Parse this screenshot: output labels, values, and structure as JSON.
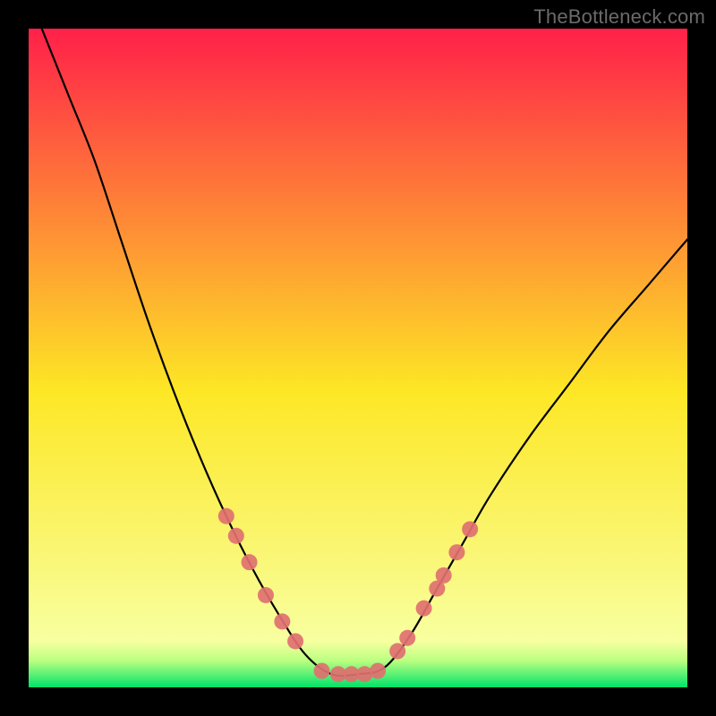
{
  "watermark": "TheBottleneck.com",
  "chart_data": {
    "type": "line",
    "x_range": [
      0,
      100
    ],
    "y_range": [
      0,
      100
    ],
    "title": "",
    "xlabel": "",
    "ylabel": "",
    "grid": false,
    "background_gradient": {
      "top_color": "#ff2049",
      "mid_color": "#fde725",
      "bottom_color": "#00e36a",
      "bottom_band_height_pct": 5
    },
    "series": [
      {
        "name": "bottleneck-curve",
        "color": "#000000",
        "width": 2.2,
        "points": [
          {
            "x": 2,
            "y": 100
          },
          {
            "x": 6,
            "y": 90
          },
          {
            "x": 10,
            "y": 80
          },
          {
            "x": 14,
            "y": 68
          },
          {
            "x": 18,
            "y": 56
          },
          {
            "x": 22,
            "y": 45
          },
          {
            "x": 26,
            "y": 35
          },
          {
            "x": 30,
            "y": 26
          },
          {
            "x": 34,
            "y": 18
          },
          {
            "x": 38,
            "y": 11
          },
          {
            "x": 42,
            "y": 5
          },
          {
            "x": 46,
            "y": 2
          },
          {
            "x": 50,
            "y": 2
          },
          {
            "x": 54,
            "y": 3
          },
          {
            "x": 58,
            "y": 8
          },
          {
            "x": 62,
            "y": 15
          },
          {
            "x": 66,
            "y": 22
          },
          {
            "x": 70,
            "y": 29
          },
          {
            "x": 76,
            "y": 38
          },
          {
            "x": 82,
            "y": 46
          },
          {
            "x": 88,
            "y": 54
          },
          {
            "x": 94,
            "y": 61
          },
          {
            "x": 100,
            "y": 68
          }
        ]
      }
    ],
    "markers": {
      "color": "#e07070",
      "radius": 9,
      "points": [
        {
          "x": 30.0,
          "y": 26
        },
        {
          "x": 31.5,
          "y": 23
        },
        {
          "x": 33.5,
          "y": 19
        },
        {
          "x": 36.0,
          "y": 14
        },
        {
          "x": 38.5,
          "y": 10
        },
        {
          "x": 40.5,
          "y": 7
        },
        {
          "x": 44.5,
          "y": 2.5
        },
        {
          "x": 47.0,
          "y": 2
        },
        {
          "x": 49.0,
          "y": 2
        },
        {
          "x": 51.0,
          "y": 2
        },
        {
          "x": 53.0,
          "y": 2.5
        },
        {
          "x": 56.0,
          "y": 5.5
        },
        {
          "x": 57.5,
          "y": 7.5
        },
        {
          "x": 60.0,
          "y": 12
        },
        {
          "x": 62.0,
          "y": 15
        },
        {
          "x": 63.0,
          "y": 17
        },
        {
          "x": 65.0,
          "y": 20.5
        },
        {
          "x": 67.0,
          "y": 24
        }
      ]
    }
  }
}
